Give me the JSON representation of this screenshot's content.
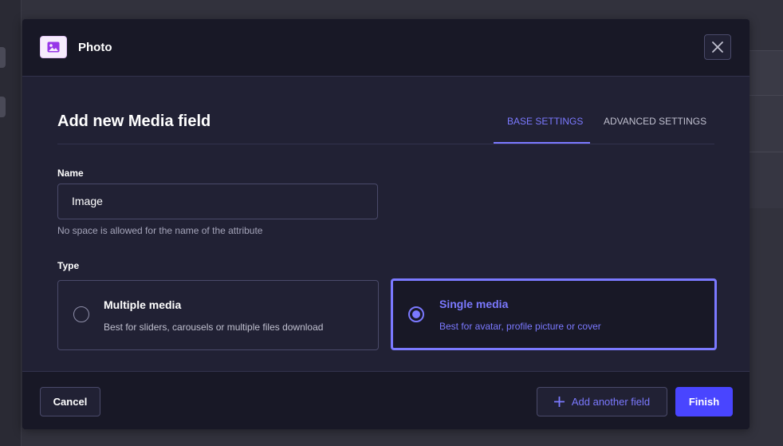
{
  "header": {
    "title": "Photo",
    "icon": "photo-icon",
    "close_icon": "close-icon"
  },
  "form": {
    "title": "Add new Media field",
    "tabs": [
      {
        "label": "BASE SETTINGS",
        "active": true
      },
      {
        "label": "ADVANCED SETTINGS",
        "active": false
      }
    ],
    "name_label": "Name",
    "name_value": "Image",
    "name_hint": "No space is allowed for the name of the attribute",
    "type_label": "Type",
    "types": [
      {
        "title": "Multiple media",
        "description": "Best for sliders, carousels or multiple files download",
        "selected": false
      },
      {
        "title": "Single media",
        "description": "Best for avatar, profile picture or cover",
        "selected": true
      }
    ]
  },
  "footer": {
    "cancel_label": "Cancel",
    "add_another_label": "Add another field",
    "add_icon": "plus-icon",
    "finish_label": "Finish"
  },
  "colors": {
    "accent": "#7b79ff",
    "primary_button": "#4945ff",
    "modal_bg": "#212134",
    "header_bg": "#181826"
  }
}
